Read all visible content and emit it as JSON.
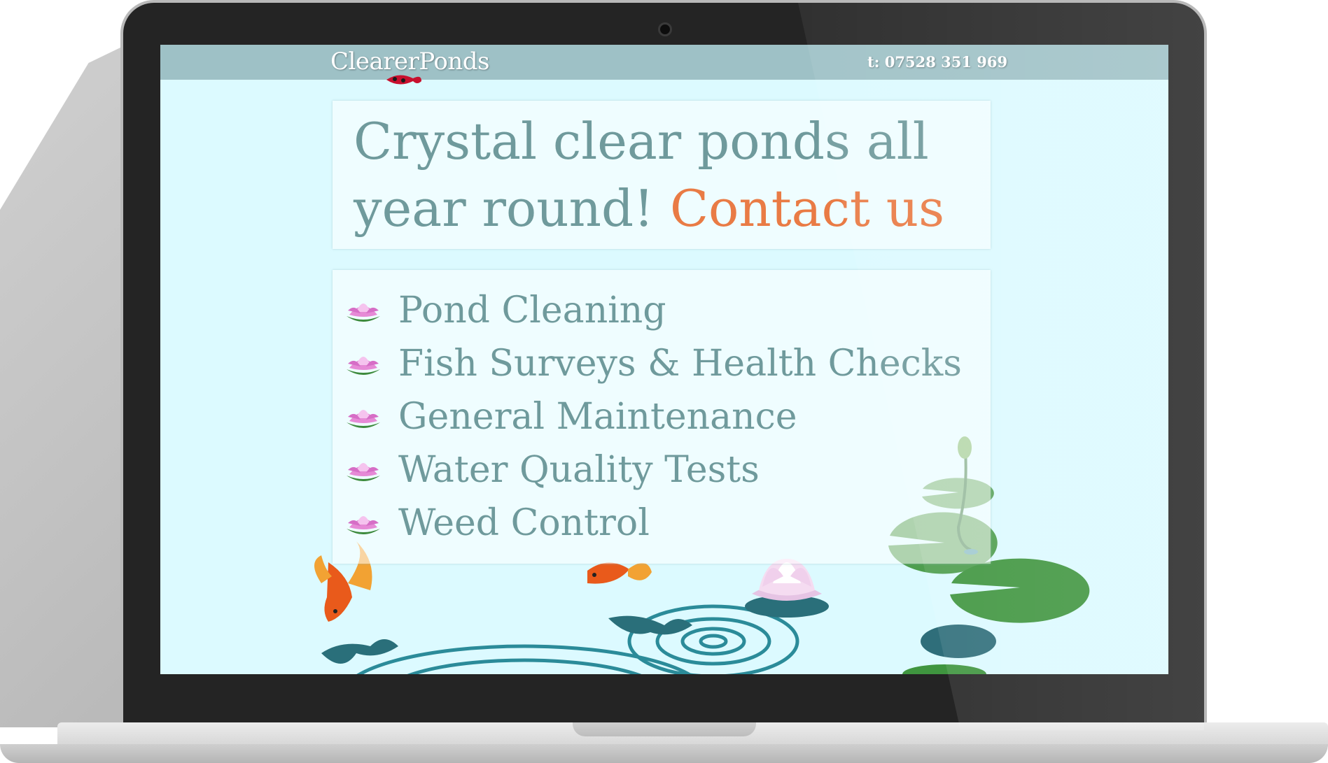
{
  "site": {
    "logo": "ClearerPonds",
    "phone": "t: 07528 351 969"
  },
  "hero": {
    "headline": "Crystal clear ponds all year round!",
    "cta": "Contact us"
  },
  "services": [
    {
      "label": "Pond Cleaning",
      "icon": "lotus-icon"
    },
    {
      "label": "Fish Surveys & Health Checks",
      "icon": "lotus-icon"
    },
    {
      "label": "General Maintenance",
      "icon": "lotus-icon"
    },
    {
      "label": "Water Quality Tests",
      "icon": "lotus-icon"
    },
    {
      "label": "Weed Control",
      "icon": "lotus-icon"
    }
  ],
  "colors": {
    "background": "#dcfaff",
    "topbar": "#9ec1c6",
    "text": "#6f9a9c",
    "accent": "#e97b45"
  }
}
